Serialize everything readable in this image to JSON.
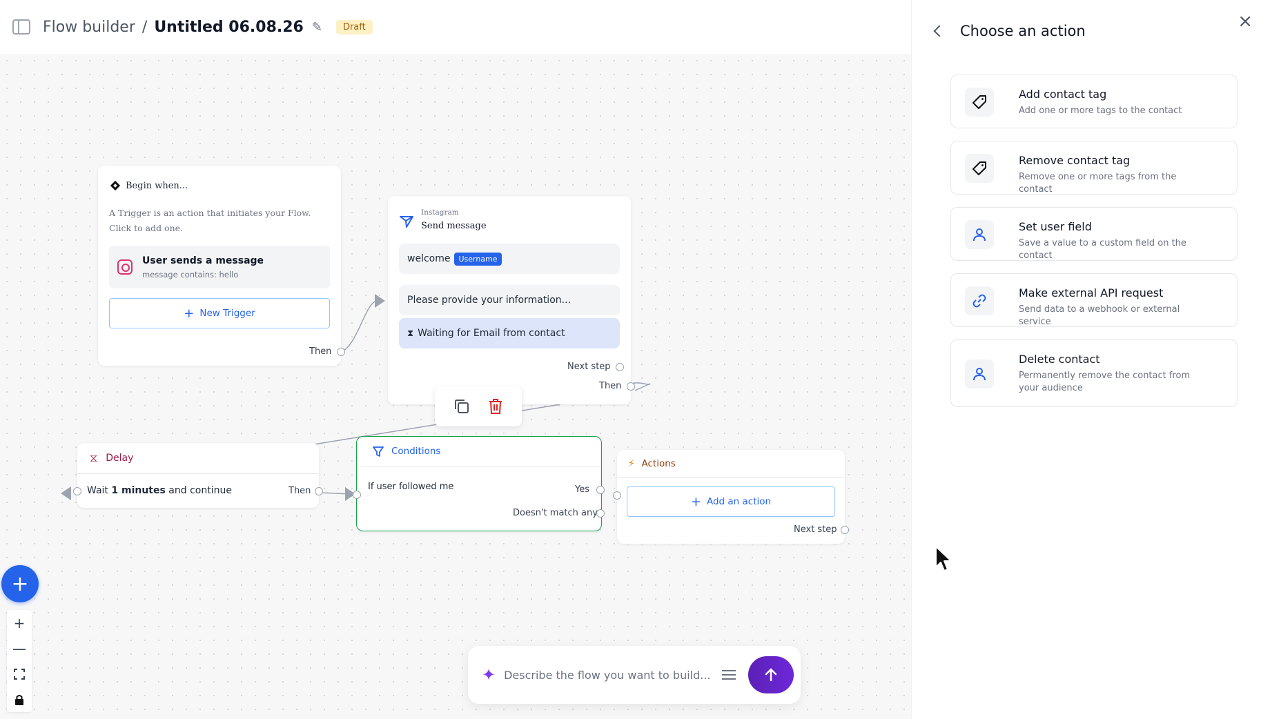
{
  "header": {
    "breadcrumb_root": "Flow builder",
    "separator": "/",
    "flow_title": "Untitled 06.08.26",
    "status_badge": "Draft"
  },
  "trigger_node": {
    "heading": "Begin when...",
    "description": "A Trigger is an action that initiates your Flow. Click to add one.",
    "event_title": "User sends a message",
    "event_subtitle": "message contains: hello",
    "new_trigger_label": "New Trigger",
    "then_label": "Then"
  },
  "send_node": {
    "channel": "Instagram",
    "title": "Send message",
    "message_text": "welcome",
    "variable_chip": "Username",
    "prompt_text": "Please provide your information...",
    "waiting_text": "Waiting for Email from contact",
    "next_step_label": "Next step",
    "then_label": "Then"
  },
  "delay_node": {
    "title": "Delay",
    "body_prefix": "Wait",
    "amount": "1 minutes",
    "body_suffix": "and continue",
    "then_label": "Then"
  },
  "conditions_node": {
    "title": "Conditions",
    "condition_text": "If user followed me",
    "yes_label": "Yes",
    "no_match_label": "Doesn't match any"
  },
  "actions_node": {
    "title": "Actions",
    "add_action_label": "Add an action",
    "next_step_label": "Next step"
  },
  "prompt_bar": {
    "placeholder": "Describe the flow you want to build..."
  },
  "panel": {
    "title": "Choose an action",
    "actions": [
      {
        "title": "Add contact tag",
        "description": "Add one or more tags to the contact",
        "icon": "tag-icon"
      },
      {
        "title": "Remove contact tag",
        "description": "Remove one or more tags from the contact",
        "icon": "tag-icon"
      },
      {
        "title": "Set user field",
        "description": "Save a value to a custom field on the contact",
        "icon": "user-icon"
      },
      {
        "title": "Make external API request",
        "description": "Send data to a webhook or external service",
        "icon": "link-icon"
      },
      {
        "title": "Delete contact",
        "description": "Permanently remove the contact from your audience",
        "icon": "user-icon"
      }
    ]
  },
  "colors": {
    "primary": "#2563eb",
    "condition_border": "#16a34a",
    "delay_accent": "#a21c4a",
    "delete_red": "#dc2626",
    "draft_badge_bg": "#fdf0c4",
    "send_button": "#6d28d9"
  }
}
